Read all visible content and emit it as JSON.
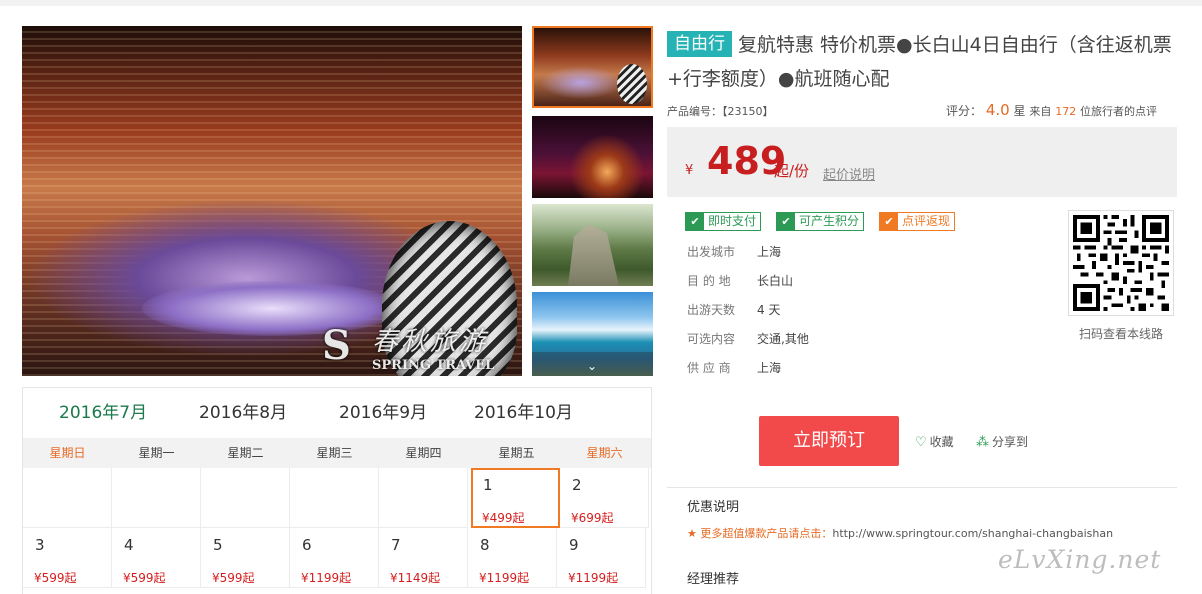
{
  "gallery": {
    "watermark_logo": "S",
    "watermark_cn": "春秋旅游",
    "watermark_en": "SPRING TRAVEL",
    "more_icon": "chevron-down-icon"
  },
  "calendar": {
    "months": [
      "2016年7月",
      "2016年8月",
      "2016年9月",
      "2016年10月"
    ],
    "active_month": "2016年7月",
    "weekdays": [
      "星期日",
      "星期一",
      "星期二",
      "星期三",
      "星期四",
      "星期五",
      "星期六"
    ],
    "weeks": [
      [
        null,
        null,
        null,
        null,
        null,
        {
          "day": "1",
          "price": "¥499起",
          "selected": true
        },
        {
          "day": "2",
          "price": "¥699起"
        }
      ],
      [
        {
          "day": "3",
          "price": "¥599起"
        },
        {
          "day": "4",
          "price": "¥599起"
        },
        {
          "day": "5",
          "price": "¥599起"
        },
        {
          "day": "6",
          "price": "¥1199起"
        },
        {
          "day": "7",
          "price": "¥1149起"
        },
        {
          "day": "8",
          "price": "¥1199起"
        },
        {
          "day": "9",
          "price": "¥1199起"
        }
      ]
    ]
  },
  "product": {
    "tag": "自由行",
    "title": "复航特惠 特价机票●长白山4日自由行（含往返机票+行李额度）●航班随心配",
    "code_label": "产品编号：【23150】",
    "score_label": "评分：",
    "score_value": "4.0",
    "score_unit": "星",
    "reviews_prefix": "来自",
    "reviews_count": "172",
    "reviews_suffix": "位旅行者的点评"
  },
  "price": {
    "currency": "¥",
    "amount": "489",
    "unit": "起/份",
    "explain_link": "起价说明"
  },
  "badges": [
    "即时支付",
    "可产生积分",
    "点评返现"
  ],
  "info": [
    {
      "label": "出发城市",
      "value": "上海"
    },
    {
      "label": "目 的 地",
      "value": "长白山"
    },
    {
      "label": "出游天数",
      "value": "4 天"
    },
    {
      "label": "可选内容",
      "value": "交通,其他"
    },
    {
      "label": "供 应 商",
      "value": "上海"
    }
  ],
  "qr": {
    "caption": "扫码查看本线路"
  },
  "actions": {
    "book": "立即预订",
    "favorite": "收藏",
    "share": "分享到"
  },
  "offers": {
    "title": "优惠说明",
    "link_text": "★ 更多超值爆款产品请点击：",
    "link_url": "http://www.springtour.com/shanghai-changbaishan"
  },
  "agent": {
    "title": "经理推荐"
  },
  "site_watermark": "eLvXing.net",
  "colors": {
    "accent_green": "#1a7a4a",
    "price_red": "#c71f1f",
    "orange": "#f07a24",
    "teal_tag": "#26b3b5",
    "book_button": "#f24a4a"
  }
}
